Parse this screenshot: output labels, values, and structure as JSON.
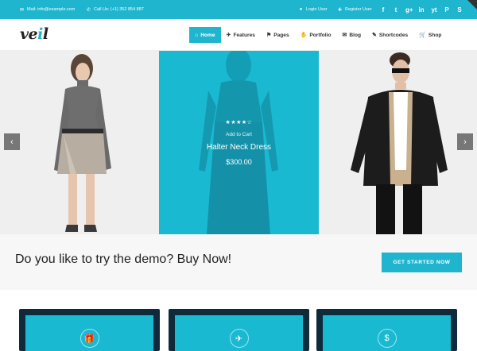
{
  "topbar": {
    "mail": "Mail: info@example.com",
    "call": "Call Us: (+1) 352 854 887",
    "login": "Login User",
    "register": "Register User",
    "social": [
      "f",
      "t",
      "g+",
      "in",
      "yt",
      "P",
      "S"
    ]
  },
  "header": {
    "logo_main": "ve",
    "logo_accent": "i",
    "logo_end": "l",
    "nav": [
      {
        "label": "Home",
        "icon": "⌂"
      },
      {
        "label": "Features",
        "icon": "✈"
      },
      {
        "label": "Pages",
        "icon": "⚑"
      },
      {
        "label": "Portfolio",
        "icon": "✋"
      },
      {
        "label": "Blog",
        "icon": "✉"
      },
      {
        "label": "Shortcodes",
        "icon": "✎"
      },
      {
        "label": "Shop",
        "icon": "🛒"
      }
    ]
  },
  "slider": {
    "stars": "★★★★☆",
    "add_to_cart": "Add to Cart",
    "product_name": "Halter Neck Dress",
    "price": "$300.00",
    "prev": "‹",
    "next": "›"
  },
  "cta": {
    "text": "Do you like to try the demo? Buy Now!",
    "button": "GET STARTED NOW"
  },
  "features": [
    {
      "icon": "🎁"
    },
    {
      "icon": "✈"
    },
    {
      "icon": "$"
    }
  ],
  "colors": {
    "accent": "#1fb5cf",
    "cta_bg": "#f7f7f7",
    "card_dark": "#0f2b3b"
  }
}
